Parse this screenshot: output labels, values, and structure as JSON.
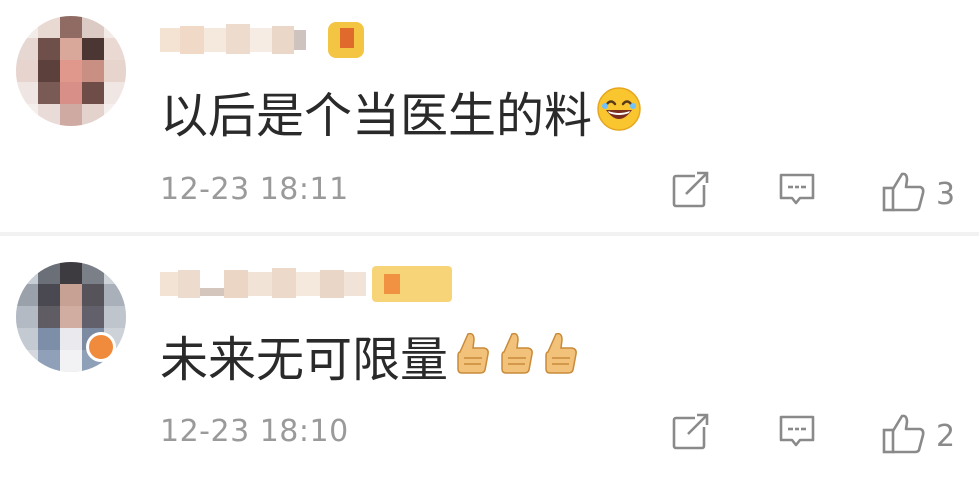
{
  "comments": [
    {
      "username": "",
      "text": "以后是个当医生的料",
      "emoji": "laughing-emoji",
      "timestamp": "12-23 18:11",
      "likes": "3",
      "colors": {
        "avatar": "#d8b3a8",
        "badge": "#f2a33a"
      }
    },
    {
      "username": "",
      "text": "未来无可限量",
      "emoji": "thumbs-up-emoji",
      "emoji_count": 3,
      "timestamp": "12-23 18:10",
      "likes": "2",
      "colors": {
        "avatar": "#b9c0cc",
        "badge": "#f08a3c"
      }
    }
  ],
  "icons": {
    "share": "share-icon",
    "reply": "comment-icon",
    "like": "thumbs-up-icon"
  }
}
